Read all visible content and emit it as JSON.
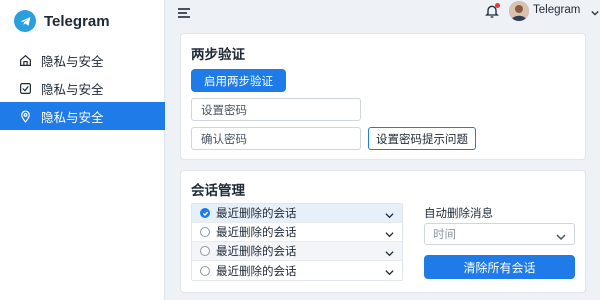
{
  "app": {
    "title": "Telegram"
  },
  "sidebar": {
    "items": [
      {
        "label": "隐私与安全",
        "icon": "home-icon",
        "active": false
      },
      {
        "label": "隐私与安全",
        "icon": "checkbox-icon",
        "active": false
      },
      {
        "label": "隐私与安全",
        "icon": "location-pin-icon",
        "active": true
      }
    ]
  },
  "header": {
    "menu_icon": "hamburger-menu-icon",
    "bell_icon": "bell-icon",
    "has_notification": true,
    "user_name": "Telegram"
  },
  "two_step": {
    "title": "两步验证",
    "enable_label": "启用两步验证",
    "password_placeholder": "设置密码",
    "confirm_placeholder": "确认密码",
    "hint_button_label": "设置密码提示问题"
  },
  "conversations": {
    "title": "会话管理",
    "rows": [
      {
        "label": "最近删除的会话",
        "checked": true
      },
      {
        "label": "最近删除的会话",
        "checked": false
      },
      {
        "label": "最近删除的会话",
        "checked": false
      },
      {
        "label": "最近删除的会话",
        "checked": false
      }
    ],
    "auto_delete_label": "自动删除消息",
    "time_placeholder": "时间",
    "clear_all_label": "清除所有会话"
  },
  "colors": {
    "accent": "#1f7be8",
    "brand_logo": "#2a9fe0",
    "notification": "#e53935"
  }
}
